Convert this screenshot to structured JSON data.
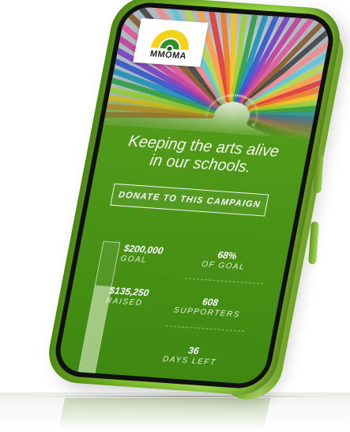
{
  "brand": {
    "logo_text": "MMOMA"
  },
  "hero": {
    "tagline_line1": "Keeping the arts alive",
    "tagline_line2": "in our schools."
  },
  "cta": {
    "donate_label": "DONATE TO THIS CAMPAIGN"
  },
  "campaign": {
    "goal_value": "$200,000",
    "goal_label": "GOAL",
    "raised_value": "$135,250",
    "raised_label": "RAISED",
    "progress_fraction": 0.68,
    "percent_value": "68%",
    "percent_label": "OF GOAL",
    "supporters_value": "608",
    "supporters_label": "SUPPORTERS",
    "days_value": "36",
    "days_label": "DAYS LEFT"
  },
  "colors": {
    "phone_green": "#7fc12c",
    "screen_green": "#4f9818",
    "logo_yellow": "#f2d21a",
    "logo_green": "#2f8f2a"
  }
}
